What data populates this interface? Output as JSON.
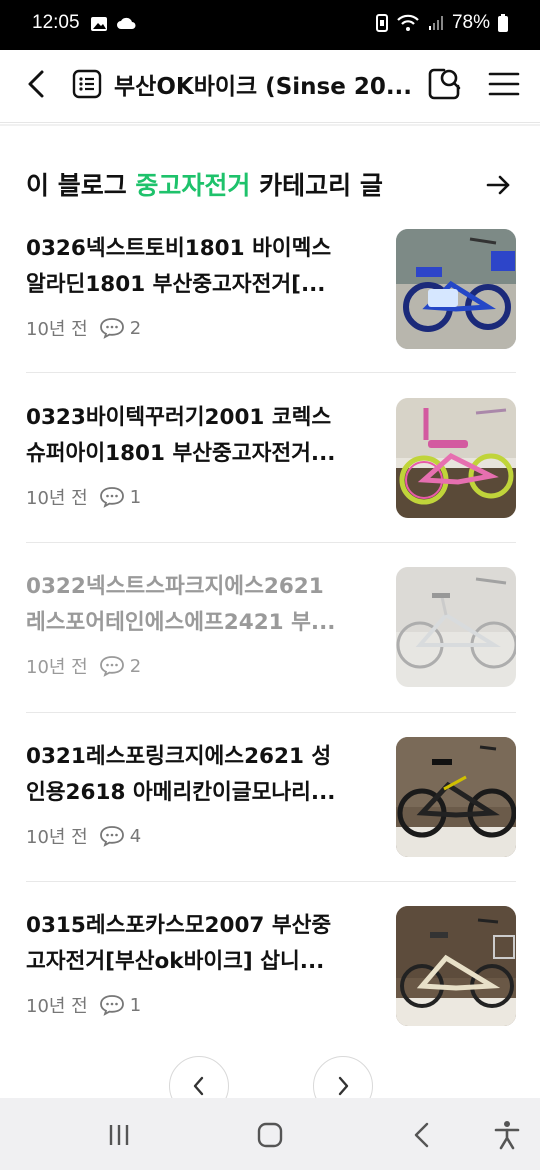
{
  "status_bar": {
    "time": "12:05",
    "battery": "78%"
  },
  "header": {
    "title": "부산OK바이크 (Sinse 20..."
  },
  "section": {
    "prefix": "이 블로그 ",
    "highlight": "중고자전거",
    "suffix": " 카테고리 글"
  },
  "posts": [
    {
      "title_line1": "0326넥스트토비1801 바이멕스",
      "title_line2": "알라딘1801 부산중고자전거[...",
      "time": "10년 전",
      "comments": "2",
      "read": false,
      "thumb": "blue-kids-bike-photo"
    },
    {
      "title_line1": "0323바이텍꾸러기2001 코렉스",
      "title_line2": "슈퍼아이1801 부산중고자전거...",
      "time": "10년 전",
      "comments": "1",
      "read": false,
      "thumb": "pink-kids-bike-photo"
    },
    {
      "title_line1": "0322넥스트스파크지에스2621",
      "title_line2": "레스포어테인에스에프2421 부...",
      "time": "10년 전",
      "comments": "2",
      "read": true,
      "thumb": "silver-bike-photo"
    },
    {
      "title_line1": "0321레스포링크지에스2621 성",
      "title_line2": "인용2618 아메리칸이글모나리...",
      "time": "10년 전",
      "comments": "4",
      "read": false,
      "thumb": "black-folding-bike-photo"
    },
    {
      "title_line1": "0315레스포카스모2007 부산중",
      "title_line2": "고자전거[부산ok바이크] 삽니...",
      "time": "10년 전",
      "comments": "1",
      "read": false,
      "thumb": "cream-bike-photo"
    }
  ],
  "colors": {
    "accent_green": "#1ec26b",
    "read_gray": "#9a9a9a"
  },
  "icons": [
    "back-arrow-icon",
    "blog-list-icon",
    "search-icon",
    "menu-icon",
    "arrow-right-icon",
    "comment-icon",
    "chevron-left-icon",
    "chevron-right-icon",
    "recent-apps-icon",
    "home-icon",
    "back-icon",
    "accessibility-icon"
  ]
}
